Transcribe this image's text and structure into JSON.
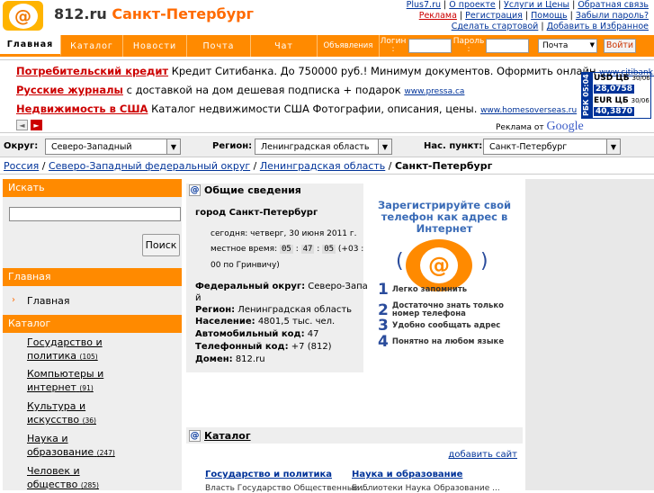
{
  "header": {
    "site_domain": "812.ru",
    "site_city": "Санкт-Петербург",
    "logo_symbol": "@",
    "links_row1": [
      "Plus7.ru",
      "О проекте",
      "Услуги и Цены",
      "Обратная связь"
    ],
    "links_row2": [
      "Реклама",
      "Регистрация",
      "Помощь",
      "Забыли пароль?"
    ],
    "links_row3": [
      "Сделать стартовой",
      "Добавить в Избранное"
    ]
  },
  "nav": {
    "tabs": [
      "Главная",
      "Каталог",
      "Новости",
      "Почта",
      "Чат",
      "Объявления"
    ],
    "login_label": "Логин :",
    "password_label": "Пароль :",
    "service_select": "Почта",
    "login_button": "Войти"
  },
  "ads": {
    "items": [
      {
        "title": "Потребительский кредит",
        "text": " Кредит Ситибанка. До 750000 руб.! Минимум документов. Оформить онлайн ",
        "url": "www.citibank.ru"
      },
      {
        "title": "Русские журналы",
        "text": " с доставкой на дом дешевая подписка + подарок ",
        "url": "www.pressa.ca"
      },
      {
        "title": "Недвижимость в США",
        "text": " Каталог недвижимости США Фотографии, описания, цены. ",
        "url": "www.homesoverseas.ru"
      }
    ],
    "prev": "◄",
    "next": "►",
    "attribution": "Реклама от",
    "google": "Google"
  },
  "rates": {
    "side": "РБК 05:04",
    "usd_label": "USD ЦБ",
    "usd_date": "30/06",
    "usd_value": "28,0758",
    "eur_label": "EUR ЦБ",
    "eur_date": "30/06",
    "eur_value": "40,3870"
  },
  "filters": {
    "okrug_label": "Округ:",
    "okrug_value": "Северо-Западный",
    "region_label": "Регион:",
    "region_value": "Ленинградская область",
    "city_label": "Нас. пункт:",
    "city_value": "Санкт-Петербург"
  },
  "breadcrumb": {
    "items": [
      "Россия",
      "Северо-Западный федеральный округ",
      "Ленинградская область"
    ],
    "sep": " / ",
    "current": "Санкт-Петербург"
  },
  "sidebar": {
    "search_heading": "Искать",
    "search_button": "Поиск",
    "main_heading": "Главная",
    "main_item": "Главная",
    "catalog_heading": "Каталог",
    "catalog": [
      {
        "name1": "Государство и",
        "name2": "политика",
        "count": "(105)"
      },
      {
        "name1": "Компьютеры и",
        "name2": "интернет",
        "count": "(91)"
      },
      {
        "name1": "Культура и",
        "name2": "искусство",
        "count": "(36)"
      },
      {
        "name1": "Наука и",
        "name2": "образование",
        "count": "(247)"
      },
      {
        "name1": "Человек и",
        "name2": "общество",
        "count": "(285)"
      }
    ]
  },
  "info": {
    "heading": "Общие сведения",
    "city_title": "город Санкт-Петербург",
    "today": "сегодня: четверг, 30 июня 2011 г.",
    "time_label": "местное время:",
    "hh": "05",
    "mm": "47",
    "ss": "05",
    "tz1": "(+03 :",
    "tz2": "00 по Гринвичу)",
    "okrug_label": "Федеральный округ:",
    "okrug_value": " Северо-Западны",
    "okrug_value2": "й",
    "region_label": "Регион:",
    "region_value": " Ленинградская область",
    "pop_label": "Население:",
    "pop_value": " 4801,5 тыс. чел.",
    "auto_label": "Автомобильный код:",
    "auto_value": " 47",
    "phone_label": "Телефонный код:",
    "phone_value": " +7 (812)",
    "domain_label": "Домен:",
    "domain_value": " 812.ru"
  },
  "banner": {
    "headline1": "Зарегистрируйте свой",
    "headline2": "телефон как адрес в",
    "headline3": "Интернет",
    "symbol": "@",
    "steps": [
      {
        "n": "1",
        "t": "Легко запомнить"
      },
      {
        "n": "2",
        "t": "Достаточно знать только номер телефона"
      },
      {
        "n": "3",
        "t": "Удобно сообщать адрес"
      },
      {
        "n": "4",
        "t": "Понятно на любом языке"
      }
    ]
  },
  "catalog_block": {
    "heading": "Каталог",
    "add_site": "добавить сайт",
    "col1": "Государство и политика",
    "col1_sub": "Власть Государство Общественные ...",
    "col2": "Наука и образование",
    "col2_sub": "Библиотеки Наука Образование ..."
  }
}
